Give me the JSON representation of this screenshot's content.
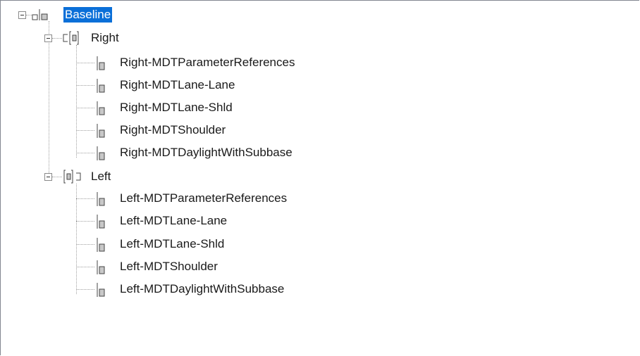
{
  "colors": {
    "selection": "#0a6fd8",
    "selection_text": "#ffffff",
    "border": "#828790"
  },
  "tree": {
    "root": {
      "label": "Baseline",
      "icon": "baseline-icon",
      "selected": true,
      "expanded": true,
      "children": [
        {
          "label": "Right",
          "icon": "region-right-icon",
          "expanded": true,
          "children": [
            {
              "label": "Right-MDTParameterReferences",
              "icon": "subassembly-icon"
            },
            {
              "label": "Right-MDTLane-Lane",
              "icon": "subassembly-icon"
            },
            {
              "label": "Right-MDTLane-Shld",
              "icon": "subassembly-icon"
            },
            {
              "label": "Right-MDTShoulder",
              "icon": "subassembly-icon"
            },
            {
              "label": "Right-MDTDaylightWithSubbase",
              "icon": "subassembly-icon"
            }
          ]
        },
        {
          "label": "Left",
          "icon": "region-left-icon",
          "expanded": true,
          "children": [
            {
              "label": "Left-MDTParameterReferences",
              "icon": "subassembly-icon"
            },
            {
              "label": "Left-MDTLane-Lane",
              "icon": "subassembly-icon"
            },
            {
              "label": "Left-MDTLane-Shld",
              "icon": "subassembly-icon"
            },
            {
              "label": "Left-MDTShoulder",
              "icon": "subassembly-icon"
            },
            {
              "label": "Left-MDTDaylightWithSubbase",
              "icon": "subassembly-icon"
            }
          ]
        }
      ]
    }
  }
}
